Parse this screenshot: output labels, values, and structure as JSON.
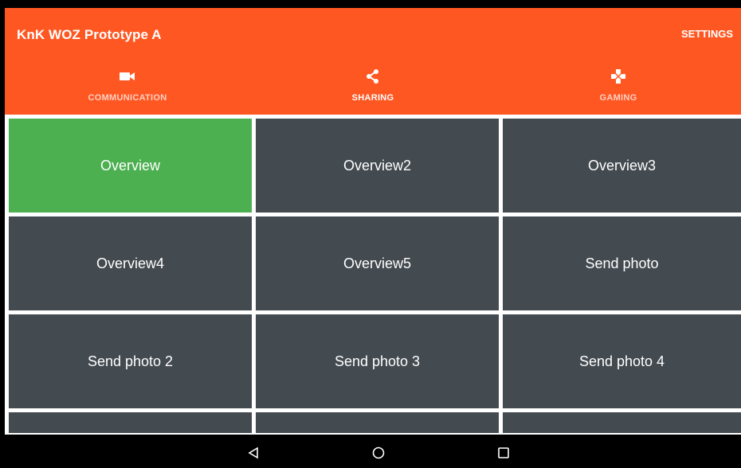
{
  "app": {
    "title": "KnK WOZ Prototype A",
    "settings_label": "SETTINGS",
    "primary_color": "#FF5722",
    "indicator_color": "#009688"
  },
  "tabs": [
    {
      "label": "COMMUNICATION",
      "icon": "video-camera-icon",
      "active": false
    },
    {
      "label": "SHARING",
      "icon": "share-icon",
      "active": true
    },
    {
      "label": "GAMING",
      "icon": "gamepad-icon",
      "active": false
    }
  ],
  "grid": {
    "cell_color": "#434A50",
    "selected_color": "#4CAF50",
    "buttons": [
      {
        "label": "Overview",
        "selected": true
      },
      {
        "label": "Overview2",
        "selected": false
      },
      {
        "label": "Overview3",
        "selected": false
      },
      {
        "label": "Overview4",
        "selected": false
      },
      {
        "label": "Overview5",
        "selected": false
      },
      {
        "label": "Send photo",
        "selected": false
      },
      {
        "label": "Send photo 2",
        "selected": false
      },
      {
        "label": "Send photo 3",
        "selected": false
      },
      {
        "label": "Send photo 4",
        "selected": false
      }
    ]
  },
  "navbar": {
    "buttons": [
      "back-icon",
      "home-icon",
      "recents-icon"
    ]
  }
}
